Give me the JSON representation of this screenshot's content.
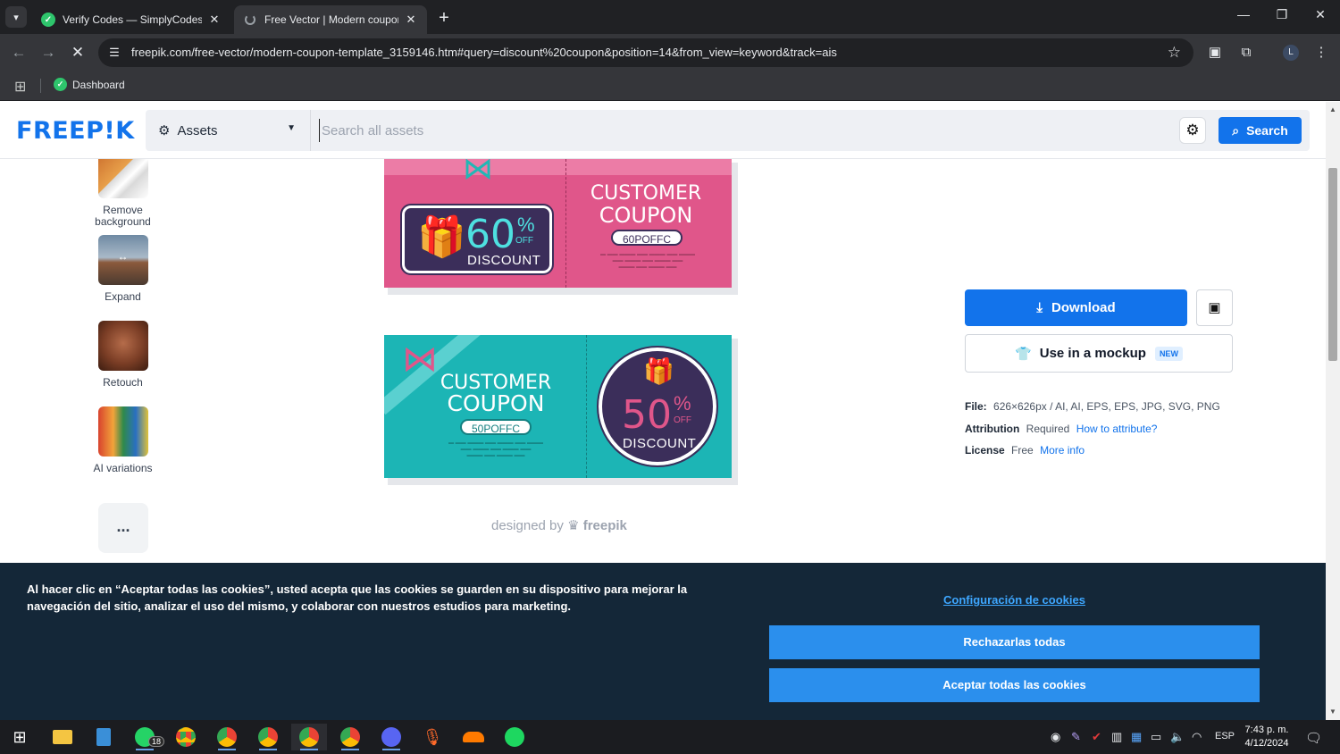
{
  "browser": {
    "tabs": [
      {
        "title": "Verify Codes — SimplyCodes",
        "active": false
      },
      {
        "title": "Free Vector | Modern coupon te",
        "active": true
      }
    ],
    "new_tab": "+",
    "url": "freepik.com/free-vector/modern-coupon-template_3159146.htm#query=discount%20coupon&position=14&from_view=keyword&track=ais",
    "profile_initial": "L",
    "bookmarks": [
      {
        "label": "Dashboard"
      }
    ]
  },
  "header": {
    "logo": "FREEP!K",
    "asset_select": "Assets",
    "search_placeholder": "Search all assets",
    "search_button": "Search"
  },
  "tools": [
    {
      "label": "Remove background"
    },
    {
      "label": "Expand"
    },
    {
      "label": "Retouch"
    },
    {
      "label": "AI variations"
    }
  ],
  "more_button": "...",
  "coupons": {
    "pink": {
      "title_line1": "CUSTOMER",
      "title_line2": "COUPON",
      "code": "60POFFC",
      "percent": "60",
      "pct_sign": "%",
      "off": "OFF",
      "discount": "DISCOUNT"
    },
    "teal": {
      "title_line1": "CUSTOMER",
      "title_line2": "COUPON",
      "code": "50POFFC",
      "percent": "50",
      "pct_sign": "%",
      "off": "OFF",
      "discount": "DISCOUNT"
    }
  },
  "designed_by": {
    "prefix": "designed by",
    "brand": "freepik"
  },
  "sidebar": {
    "download": "Download",
    "mockup": "Use in a mockup",
    "mockup_badge": "NEW",
    "file_label": "File:",
    "file_value": "626×626px / AI, AI, EPS, EPS, JPG, SVG, PNG",
    "attribution_label": "Attribution",
    "attribution_value": "Required",
    "attribution_link": "How to attribute?",
    "license_label": "License",
    "license_value": "Free",
    "license_link": "More info"
  },
  "cookie_banner": {
    "text": "Al hacer clic en “Aceptar todas las cookies”, usted acepta que las cookies se guarden en su dispositivo para mejorar la navegación del sitio, analizar el uso del mismo, y colaborar con nuestros estudios para marketing.",
    "settings_link": "Configuración de cookies",
    "reject": "Rechazarlas todas",
    "accept": "Aceptar todas las cookies"
  },
  "taskbar": {
    "whatsapp_badge": "18",
    "language": "ESP",
    "time": "7:43 p. m.",
    "date": "4/12/2024"
  },
  "colors": {
    "brand_blue": "#1273eb",
    "cookie_bg": "#142738",
    "cookie_button": "#2b8fed",
    "coupon_pink": "#e0568a",
    "coupon_teal": "#1cb5b5",
    "coupon_navy": "#3b2e5a"
  }
}
